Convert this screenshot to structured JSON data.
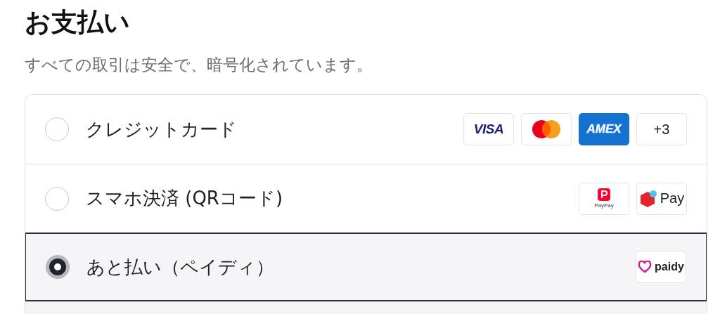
{
  "title": "お支払い",
  "subtitle": "すべての取引は安全で、暗号化されています。",
  "methods": [
    {
      "label": "クレジットカード",
      "selected": false,
      "badges": [
        {
          "kind": "visa",
          "text": "VISA"
        },
        {
          "kind": "mastercard"
        },
        {
          "kind": "amex",
          "text": "AMEX"
        },
        {
          "kind": "more",
          "text": "+3"
        }
      ]
    },
    {
      "label": "スマホ決済 (QRコード)",
      "selected": false,
      "badges": [
        {
          "kind": "paypay",
          "text": "PayPay"
        },
        {
          "kind": "merpay",
          "text": "Pay"
        }
      ]
    },
    {
      "label": "あと払い（ペイディ）",
      "selected": true,
      "badges": [
        {
          "kind": "paidy",
          "text": "paidy"
        }
      ]
    }
  ]
}
